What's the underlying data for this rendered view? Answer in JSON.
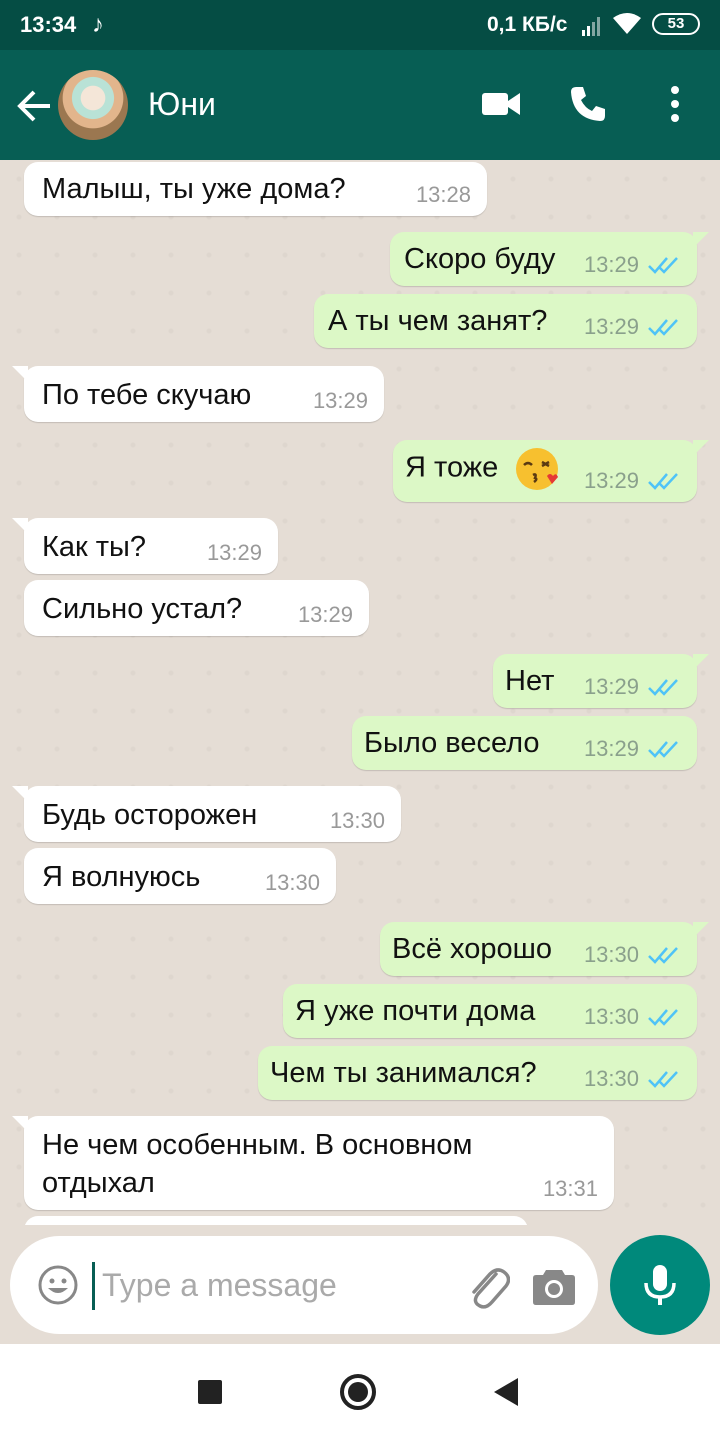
{
  "status_bar": {
    "time": "13:34",
    "notification_icon": "tiktok-icon",
    "network_speed": "0,1 КБ/с",
    "battery": "53"
  },
  "header": {
    "contact_name": "Юни",
    "icons": [
      "back-arrow-icon",
      "video-call-icon",
      "phone-icon",
      "more-vert-icon"
    ]
  },
  "messages": [
    {
      "dir": "in",
      "text": "Малыш, ты уже дома?",
      "time": "13:28"
    },
    {
      "dir": "out",
      "text": "Скоро буду",
      "time": "13:29"
    },
    {
      "dir": "out",
      "text": "А ты чем занят?",
      "time": "13:29"
    },
    {
      "dir": "in",
      "text": "По тебе скучаю",
      "time": "13:29"
    },
    {
      "dir": "out",
      "text": "Я тоже",
      "time": "13:29",
      "emoji": "kissing-face-emoji"
    },
    {
      "dir": "in",
      "text": "Как ты?",
      "time": "13:29"
    },
    {
      "dir": "in",
      "text": "Сильно устал?",
      "time": "13:29"
    },
    {
      "dir": "out",
      "text": "Нет",
      "time": "13:29"
    },
    {
      "dir": "out",
      "text": "Было весело",
      "time": "13:29"
    },
    {
      "dir": "in",
      "text": "Будь осторожен",
      "time": "13:30"
    },
    {
      "dir": "in",
      "text": "Я волнуюсь",
      "time": "13:30"
    },
    {
      "dir": "out",
      "text": "Всё хорошо",
      "time": "13:30"
    },
    {
      "dir": "out",
      "text": "Я уже почти дома",
      "time": "13:30"
    },
    {
      "dir": "out",
      "text": "Чем ты занимался?",
      "time": "13:30"
    },
    {
      "dir": "in",
      "text": "Не чем особенным. В основном",
      "text2": "отдыхал",
      "time": "13:31"
    }
  ],
  "composer": {
    "placeholder": "Type a message"
  },
  "colors": {
    "header": "#075e54",
    "status_bar": "#054d44",
    "outgoing_bubble": "#dcf8c6",
    "incoming_bubble": "#ffffff",
    "read_ticks": "#4fc3f7",
    "mic_button": "#00897b"
  }
}
